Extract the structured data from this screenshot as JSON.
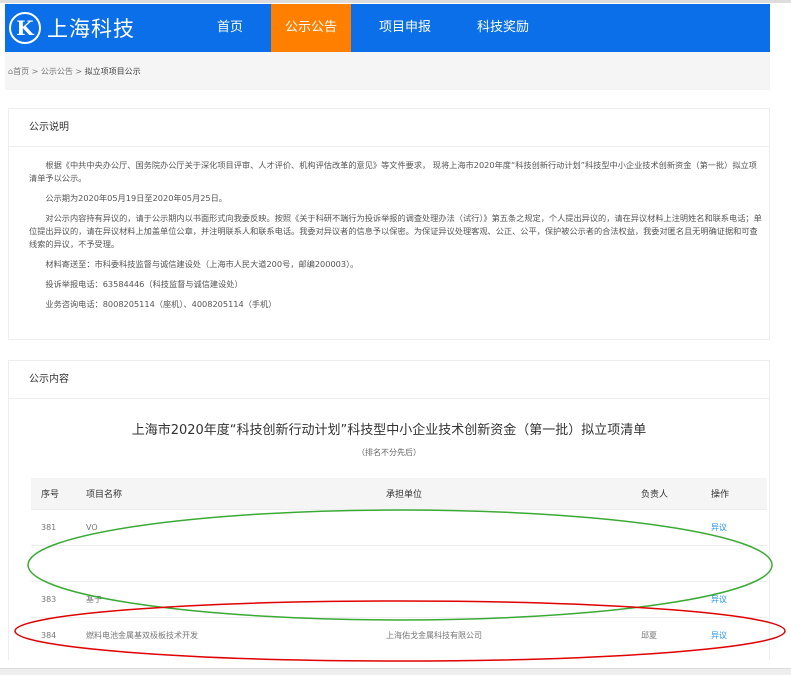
{
  "nav": {
    "logo_letter": "K",
    "logo_text": "上海科技",
    "items": [
      "首页",
      "公示公告",
      "项目申报",
      "科技奖励"
    ],
    "active_index": 1,
    "brand_color": "#0a6fe8",
    "active_color": "#ff8000"
  },
  "breadcrumb": {
    "home": "首页",
    "sep": ">",
    "items": [
      "公示公告",
      "拟立项项目公示"
    ]
  },
  "notice": {
    "title": "公示说明",
    "paragraphs": [
      "根据《中共中央办公厅、国务院办公厅关于深化项目评审、人才评价、机构评估改革的意见》等文件要求， 现将上海市2020年度“科技创新行动计划”科技型中小企业技术创新资金（第一批）拟立项清单予以公示。",
      "公示期为2020年05月19日至2020年05月25日。",
      "对公示内容持有异议的，请于公示期内以书面形式向我委反映。按照《关于科研不端行为投诉举报的调查处理办法（试行）》第五条之规定，个人提出异议的，请在异议材料上注明姓名和联系电话；单位提出异议的，请在异议材料上加盖单位公章，并注明联系人和联系电话。我委对异议者的信息予以保密。为保证异议处理客观、公正、公平，保护被公示者的合法权益，我委对匿名且无明确证据和可查线索的异议，不予受理。",
      "材料寄送至：市科委科技监督与诚信建设处（上海市人民大道200号，邮编200003）。",
      "投诉举报电话：63584446（科技监督与诚信建设处）",
      "业务咨询电话：8008205114（座机）、4008205114（手机）"
    ]
  },
  "content": {
    "title": "公示内容",
    "list_title": "上海市2020年度“科技创新行动计划”科技型中小企业技术创新资金（第一批）拟立项清单",
    "list_subtitle": "（排名不分先后）",
    "columns": [
      "序号",
      "项目名称",
      "承担单位",
      "负责人",
      "操作"
    ],
    "rows": [
      {
        "no": "381",
        "name": "VO",
        "org": "",
        "owner": "",
        "action": "异议"
      },
      {
        "no": "",
        "name": "",
        "org": "",
        "owner": "",
        "action": ""
      },
      {
        "no": "383",
        "name": "基于",
        "org": "",
        "owner": "",
        "action": "异议"
      },
      {
        "no": "384",
        "name": "燃料电池金属基双极板技术开发",
        "org": "上海佑戈金属科技有限公司",
        "owner": "邱夏",
        "action": "异议"
      }
    ]
  },
  "annotations": {
    "green": "#3aaa35",
    "red": "#e00000"
  }
}
